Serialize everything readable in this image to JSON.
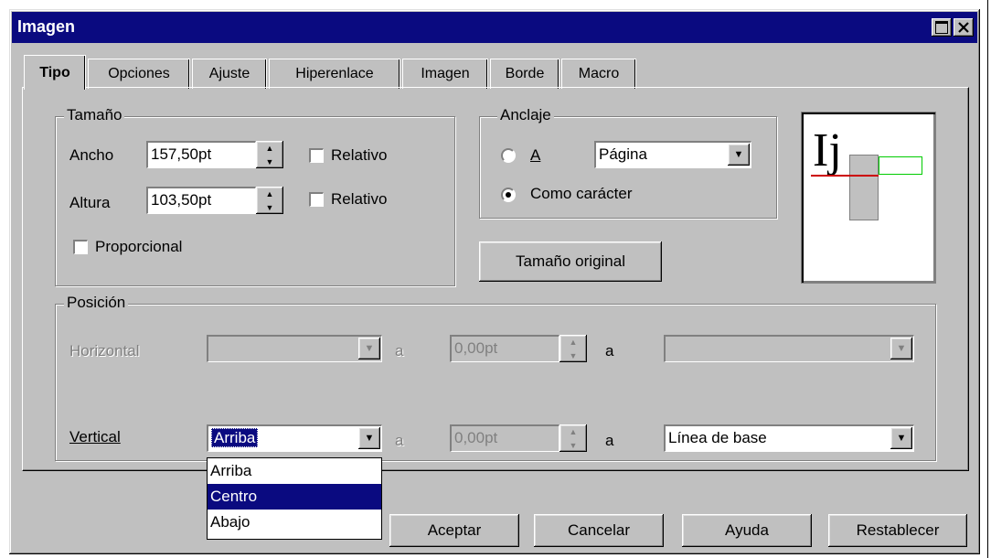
{
  "window": {
    "title": "Imagen"
  },
  "tabs": [
    {
      "label": "Tipo"
    },
    {
      "label": "Opciones"
    },
    {
      "label": "Ajuste"
    },
    {
      "label": "Hiperenlace"
    },
    {
      "label": "Imagen"
    },
    {
      "label": "Borde"
    },
    {
      "label": "Macro"
    }
  ],
  "size": {
    "group_label": "Tamaño",
    "width_label": "Ancho",
    "width_value": "157,50pt",
    "height_label": "Altura",
    "height_value": "103,50pt",
    "relative_label": "Relativo",
    "proportional_label": "Proporcional"
  },
  "anchor": {
    "group_label": "Anclaje",
    "option_a": "A",
    "option_a_select": "Página",
    "option_char": "Como carácter"
  },
  "original_size_button": "Tamaño original",
  "preview": {
    "glyphs": "Ij",
    "baseline_color": "#cc0000",
    "frame_color": "#00cc00"
  },
  "position": {
    "group_label": "Posición",
    "horizontal_label": "Horizontal",
    "horizontal_value": "",
    "horizontal_to": "a",
    "horizontal_offset": "0,00pt",
    "horizontal_to2": "a",
    "horizontal_ref": "",
    "vertical_label": "Vertical",
    "vertical_value": "Arriba",
    "vertical_to": "a",
    "vertical_offset": "0,00pt",
    "vertical_to2": "a",
    "vertical_ref": "Línea de base"
  },
  "dropdown": {
    "items": [
      "Arriba",
      "Centro",
      "Abajo"
    ],
    "selected": "Centro"
  },
  "buttons": {
    "ok": "Aceptar",
    "cancel": "Cancelar",
    "help": "Ayuda",
    "reset": "Restablecer"
  },
  "colors": {
    "titlebar": "#0a0a80",
    "face": "#c0c0c0",
    "selection": "#0a0a80"
  }
}
